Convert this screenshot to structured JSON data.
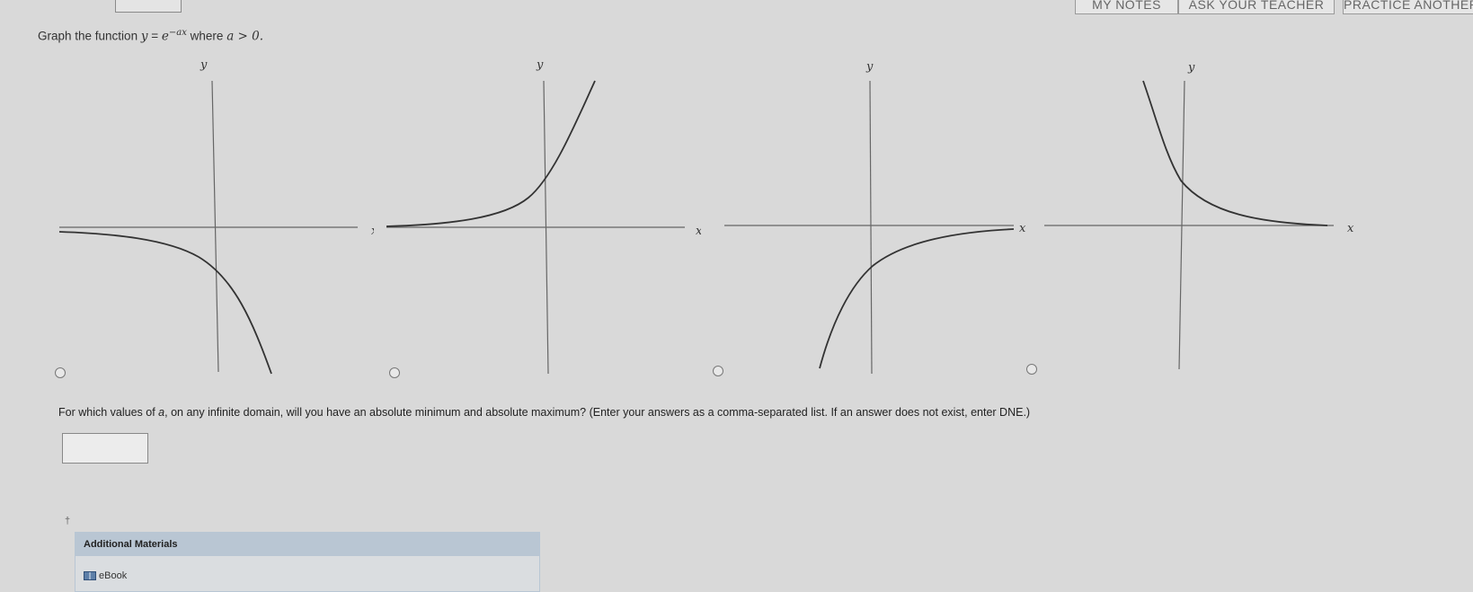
{
  "header": {
    "buttons": [
      {
        "label": "MY NOTES"
      },
      {
        "label": "ASK YOUR TEACHER"
      },
      {
        "label": "PRACTICE ANOTHER"
      }
    ]
  },
  "question": {
    "intro": "Graph the function",
    "lhs": "y",
    "equals": "=",
    "base": "e",
    "exponent": "−ax",
    "condition_prefix": "where",
    "condition": "a > 0."
  },
  "graphs": [
    {
      "x_label": "x",
      "y_label": "y"
    },
    {
      "x_label": "x",
      "y_label": "y"
    },
    {
      "x_label": "x",
      "y_label": "y"
    },
    {
      "x_label": "x",
      "y_label": "y"
    }
  ],
  "prompt": {
    "text_before": "For which values of",
    "variable": "a",
    "text_after": ", on any infinite domain, will you have an absolute minimum and absolute maximum? (Enter your answers as a comma-separated list. If an answer does not exist, enter DNE.)"
  },
  "answer": {
    "value": ""
  },
  "footnote": "†",
  "materials": {
    "title": "Additional Materials",
    "items": [
      {
        "label": "eBook",
        "icon": "book-icon"
      }
    ]
  }
}
